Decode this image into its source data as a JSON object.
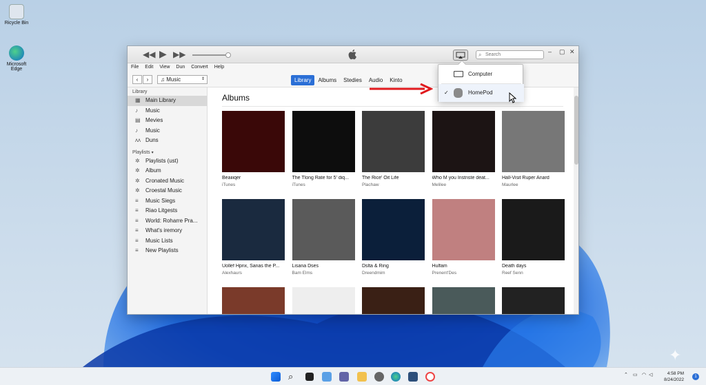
{
  "desktop": {
    "icons": [
      {
        "label": "Recycle Bin",
        "caption": "Ricycle Bin"
      },
      {
        "label": "Microsoft Edge",
        "caption": "Microsoft Edge"
      }
    ]
  },
  "window": {
    "search_placeholder": "Search",
    "menu": [
      "File",
      "Edit",
      "View",
      "Dun",
      "Convert",
      "Help"
    ],
    "media_selector": "Music",
    "tabs": [
      {
        "label": "Library",
        "active": true
      },
      {
        "label": "Albums"
      },
      {
        "label": "Stedies"
      },
      {
        "label": "Audio"
      },
      {
        "label": "Kinto"
      }
    ],
    "sidebar": {
      "library_header": "Library",
      "library": [
        {
          "label": "Main Library",
          "icon": "grid-icon",
          "selected": true
        },
        {
          "label": "Music",
          "icon": "note-icon"
        },
        {
          "label": "Mevies",
          "icon": "film-icon"
        },
        {
          "label": "Music",
          "icon": "note-icon"
        },
        {
          "label": "Duns",
          "icon": "podcast-icon"
        }
      ],
      "playlists_header": "Playlists",
      "playlists": [
        {
          "label": "Playlists (ust)",
          "icon": "gear-icon"
        },
        {
          "label": "Album",
          "icon": "gear-icon"
        },
        {
          "label": "Cronated Music",
          "icon": "gear-icon"
        },
        {
          "label": "Croestal Music",
          "icon": "gear-icon"
        },
        {
          "label": "Music Siegs",
          "icon": "playlist-icon"
        },
        {
          "label": "Riao Litgests",
          "icon": "playlist-icon"
        },
        {
          "label": "World: Roharre Pra...",
          "icon": "playlist-icon"
        },
        {
          "label": "What's iremory",
          "icon": "playlist-icon"
        },
        {
          "label": "Music Lists",
          "icon": "playlist-icon"
        },
        {
          "label": "New Playlists",
          "icon": "playlist-icon"
        }
      ]
    },
    "content_title": "Albums",
    "albums": [
      {
        "title": "Beaiiiqer",
        "artist": "iTunes",
        "color": "#3a0808"
      },
      {
        "title": "The Tlong Rate for 5' diq...",
        "artist": "iTunes",
        "color": "#0d0d0d"
      },
      {
        "title": "The Rice' Oit Life",
        "artist": "Plachaw",
        "color": "#3c3c3c"
      },
      {
        "title": "Who M you Instnste deat...",
        "artist": "Melilee",
        "color": "#1c1414"
      },
      {
        "title": "Hall-Visit Ruper Anard",
        "artist": "Maurlee",
        "color": "#777777"
      },
      {
        "title": "Uollef Hpnx, Sanas the P...",
        "artist": "Alexhaurs",
        "color": "#1a2a3f"
      },
      {
        "title": "Lisana Dses",
        "artist": "Bam Elms",
        "color": "#5a5a5a"
      },
      {
        "title": "Dslta & Ring",
        "artist": "Dreendmim",
        "color": "#0b1f3a"
      },
      {
        "title": "Hulfam",
        "artist": "Prenent'Des",
        "color": "#c08080"
      },
      {
        "title": "Death days",
        "artist": "Reef Senn",
        "color": "#1a1a1a"
      },
      {
        "title": "",
        "artist": "",
        "color": "#7a3a2a"
      },
      {
        "title": "",
        "artist": "",
        "color": "#eeeeee"
      },
      {
        "title": "",
        "artist": "",
        "color": "#3a2015"
      },
      {
        "title": "",
        "artist": "",
        "color": "#4a5a5a"
      },
      {
        "title": "",
        "artist": "",
        "color": "#222222"
      }
    ],
    "airplay_popup": {
      "options": [
        {
          "label": "Computer",
          "checked": false
        },
        {
          "label": "HomePod",
          "checked": true
        }
      ]
    }
  },
  "taskbar": {
    "time": "4:58 PM",
    "date": "8/24/2022",
    "notification_count": "1"
  },
  "colors": {
    "accent": "#2b6fd6",
    "annotation_arrow": "#e0181c"
  }
}
